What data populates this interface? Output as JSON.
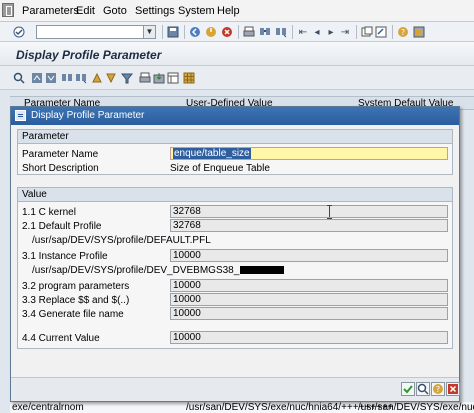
{
  "menubar": {
    "items": [
      "Parameters",
      "Edit",
      "Goto",
      "Settings",
      "System",
      "Help"
    ],
    "mnemonics": [
      "P",
      "E",
      "G",
      "S",
      "y",
      "H"
    ]
  },
  "toolbar": {
    "command_field_value": "",
    "icons": [
      "enter-icon",
      "save-icon",
      "back-icon",
      "exit-icon",
      "cancel-icon",
      "print-icon",
      "find-icon",
      "find-next-icon",
      "first-page-icon",
      "previous-page-icon",
      "next-page-icon",
      "last-page-icon",
      "create-session-icon",
      "shortcut-icon",
      "help-icon",
      "layout-menu-icon"
    ]
  },
  "title": "Display Profile Parameter",
  "app_toolbar_icons": [
    "details-icon",
    "sort-ascending-icon",
    "sort-descending-icon",
    "find-icon",
    "find-next-icon",
    "filter-icon",
    "print-icon",
    "export-icon",
    "layout-icon",
    "grid-icon"
  ],
  "background_table": {
    "columns": [
      "Parameter Name",
      "User-Defined Value",
      "System Default Value"
    ],
    "last_row": {
      "name": "exe/centralrnom",
      "user_value": "/usr/san/DEV/SYS/exe/nuc/hnia64/+++++++++",
      "default_value": "/usr/san/DEV/SYS/exe/nuc"
    }
  },
  "dialog": {
    "title": "Display Profile Parameter",
    "parameter_group": {
      "title": "Parameter",
      "name_label": "Parameter Name",
      "name_value": "enque/table_size",
      "desc_label": "Short Description",
      "desc_value": "Size of Enqueue Table"
    },
    "value_group": {
      "title": "Value",
      "c_kernel_label": "1.1 C kernel",
      "c_kernel_value": "32768",
      "default_profile_label": "2.1 Default Profile",
      "default_profile_value": "32768",
      "default_profile_path": "/usr/sap/DEV/SYS/profile/DEFAULT.PFL",
      "instance_profile_label": "3.1 Instance Profile",
      "instance_profile_value": "10000",
      "instance_profile_path": "/usr/sap/DEV/SYS/profile/DEV_DVEBMGS38_",
      "program_params_label": "3.2 program parameters",
      "program_params_value": "10000",
      "replace_label": "3.3 Replace $$ and $(..)",
      "replace_value": "10000",
      "generate_label": "3.4 Generate file name",
      "generate_value": "10000",
      "current_label": "4.4 Current Value",
      "current_value": "10000"
    },
    "footer_icons": [
      "continue-icon",
      "find-icon",
      "help-icon",
      "cancel-icon"
    ]
  },
  "colors": {
    "dialog_title_bar": "#2a5d9e",
    "edit_field": "#fff6a8",
    "selection": "#2f5e9e",
    "continue_green": "#2e9a2e",
    "cancel_red": "#c0392b"
  }
}
